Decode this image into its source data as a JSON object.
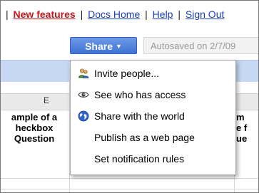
{
  "topbar": {
    "links": [
      {
        "label": "New features",
        "color": "#c4161c"
      },
      {
        "label": "Docs Home"
      },
      {
        "label": "Help"
      },
      {
        "label": "Sign Out"
      }
    ],
    "separator": "|"
  },
  "toolbar": {
    "share_label": "Share",
    "share_caret": "▼",
    "autosaved_text": "Autosaved on 2/7/09"
  },
  "sheet": {
    "column_header": "E",
    "cell_left_lines": [
      "ample of a",
      "heckbox",
      "Question"
    ],
    "cell_right_lines": [
      "m",
      "e f",
      "ue"
    ]
  },
  "share_menu": {
    "items": [
      {
        "label": "Invite people...",
        "icon": "people-icon"
      },
      {
        "label": "See who has access",
        "icon": "eye-icon"
      },
      {
        "label": "Share with the world",
        "icon": "globe-icon"
      },
      {
        "label": "Publish as a web page",
        "icon": ""
      },
      {
        "label": "Set notification rules",
        "icon": ""
      }
    ]
  },
  "colors": {
    "share_button": "#4a7fdc",
    "link": "#1a3fbf",
    "header_band": "#c7d8f4"
  }
}
